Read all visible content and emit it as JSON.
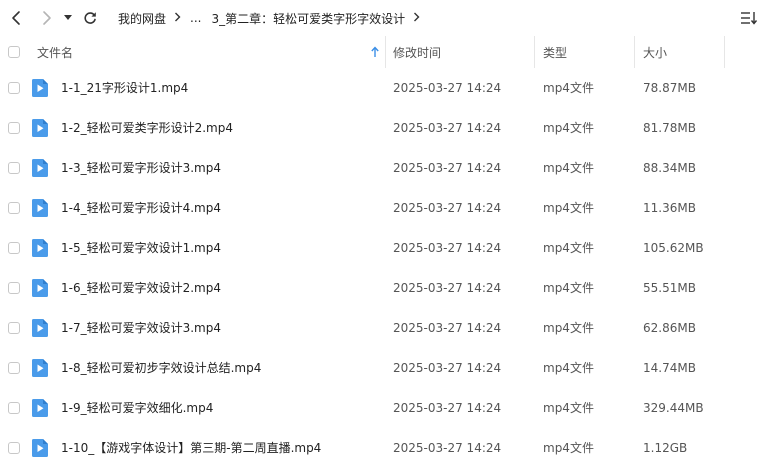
{
  "toolbar": {
    "breadcrumb": {
      "root": "我的网盘",
      "ellipsis": "...",
      "current": "3_第二章：轻松可爱类字形字效设计"
    }
  },
  "columns": {
    "name": "文件名",
    "modified": "修改时间",
    "type": "类型",
    "size": "大小"
  },
  "files": [
    {
      "name": "1-1_21字形设计1.mp4",
      "modified": "2025-03-27 14:24",
      "type": "mp4文件",
      "size": "78.87MB"
    },
    {
      "name": "1-2_轻松可爱类字形设计2.mp4",
      "modified": "2025-03-27 14:24",
      "type": "mp4文件",
      "size": "81.78MB"
    },
    {
      "name": "1-3_轻松可爱字形设计3.mp4",
      "modified": "2025-03-27 14:24",
      "type": "mp4文件",
      "size": "88.34MB"
    },
    {
      "name": "1-4_轻松可爱字形设计4.mp4",
      "modified": "2025-03-27 14:24",
      "type": "mp4文件",
      "size": "11.36MB"
    },
    {
      "name": "1-5_轻松可爱字效设计1.mp4",
      "modified": "2025-03-27 14:24",
      "type": "mp4文件",
      "size": "105.62MB"
    },
    {
      "name": "1-6_轻松可爱字效设计2.mp4",
      "modified": "2025-03-27 14:24",
      "type": "mp4文件",
      "size": "55.51MB"
    },
    {
      "name": "1-7_轻松可爱字效设计3.mp4",
      "modified": "2025-03-27 14:24",
      "type": "mp4文件",
      "size": "62.86MB"
    },
    {
      "name": "1-8_轻松可爱初步字效设计总结.mp4",
      "modified": "2025-03-27 14:24",
      "type": "mp4文件",
      "size": "14.74MB"
    },
    {
      "name": "1-9_轻松可爱字效细化.mp4",
      "modified": "2025-03-27 14:24",
      "type": "mp4文件",
      "size": "329.44MB"
    },
    {
      "name": "1-10_【游戏字体设计】第三期-第二周直播.mp4",
      "modified": "2025-03-27 14:24",
      "type": "mp4文件",
      "size": "1.12GB"
    }
  ],
  "colors": {
    "file_icon": "#4a9bea",
    "header_divider": "#e6e6e6",
    "sort_arrow": "#3a8ee6"
  },
  "icons": {
    "back": "chevron-left-icon",
    "forward": "chevron-right-icon",
    "history": "caret-down-icon",
    "refresh": "refresh-icon",
    "view": "list-view-icon",
    "sort": "sort-ascending-icon",
    "file": "video-file-icon"
  }
}
